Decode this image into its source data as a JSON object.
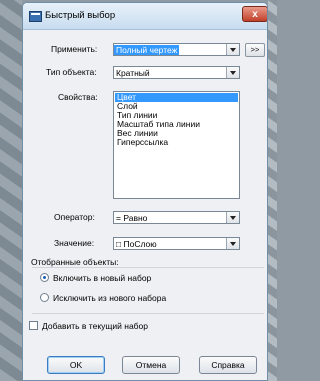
{
  "window": {
    "title": "Быстрый выбор",
    "close_label": "x"
  },
  "form": {
    "apply_label": "Применить:",
    "apply_value": "Полный чертеж",
    "pick_button_label": ">>",
    "object_type_label": "Тип объекта:",
    "object_type_value": "Кратный",
    "properties_label": "Свойства:",
    "properties": [
      {
        "label": "Цвет",
        "selected": true
      },
      {
        "label": "Слой",
        "selected": false
      },
      {
        "label": "Тип линии",
        "selected": false
      },
      {
        "label": "Масштаб типа линии",
        "selected": false
      },
      {
        "label": "Вес линии",
        "selected": false
      },
      {
        "label": "Гиперссылка",
        "selected": false
      }
    ],
    "operator_label": "Оператор:",
    "operator_value": "= Равно",
    "value_label": "Значение:",
    "value_value": "□ ПоСлою",
    "selection_group_label": "Отобранные объекты:",
    "radio_include_label": "Включить в новый набор",
    "radio_exclude_label": "Исключить из нового набора",
    "radio_selected": "include",
    "append_checkbox_label": "Добавить в текущий набор",
    "append_checked": false
  },
  "buttons": {
    "ok": "OK",
    "cancel": "Отмена",
    "help": "Справка"
  }
}
